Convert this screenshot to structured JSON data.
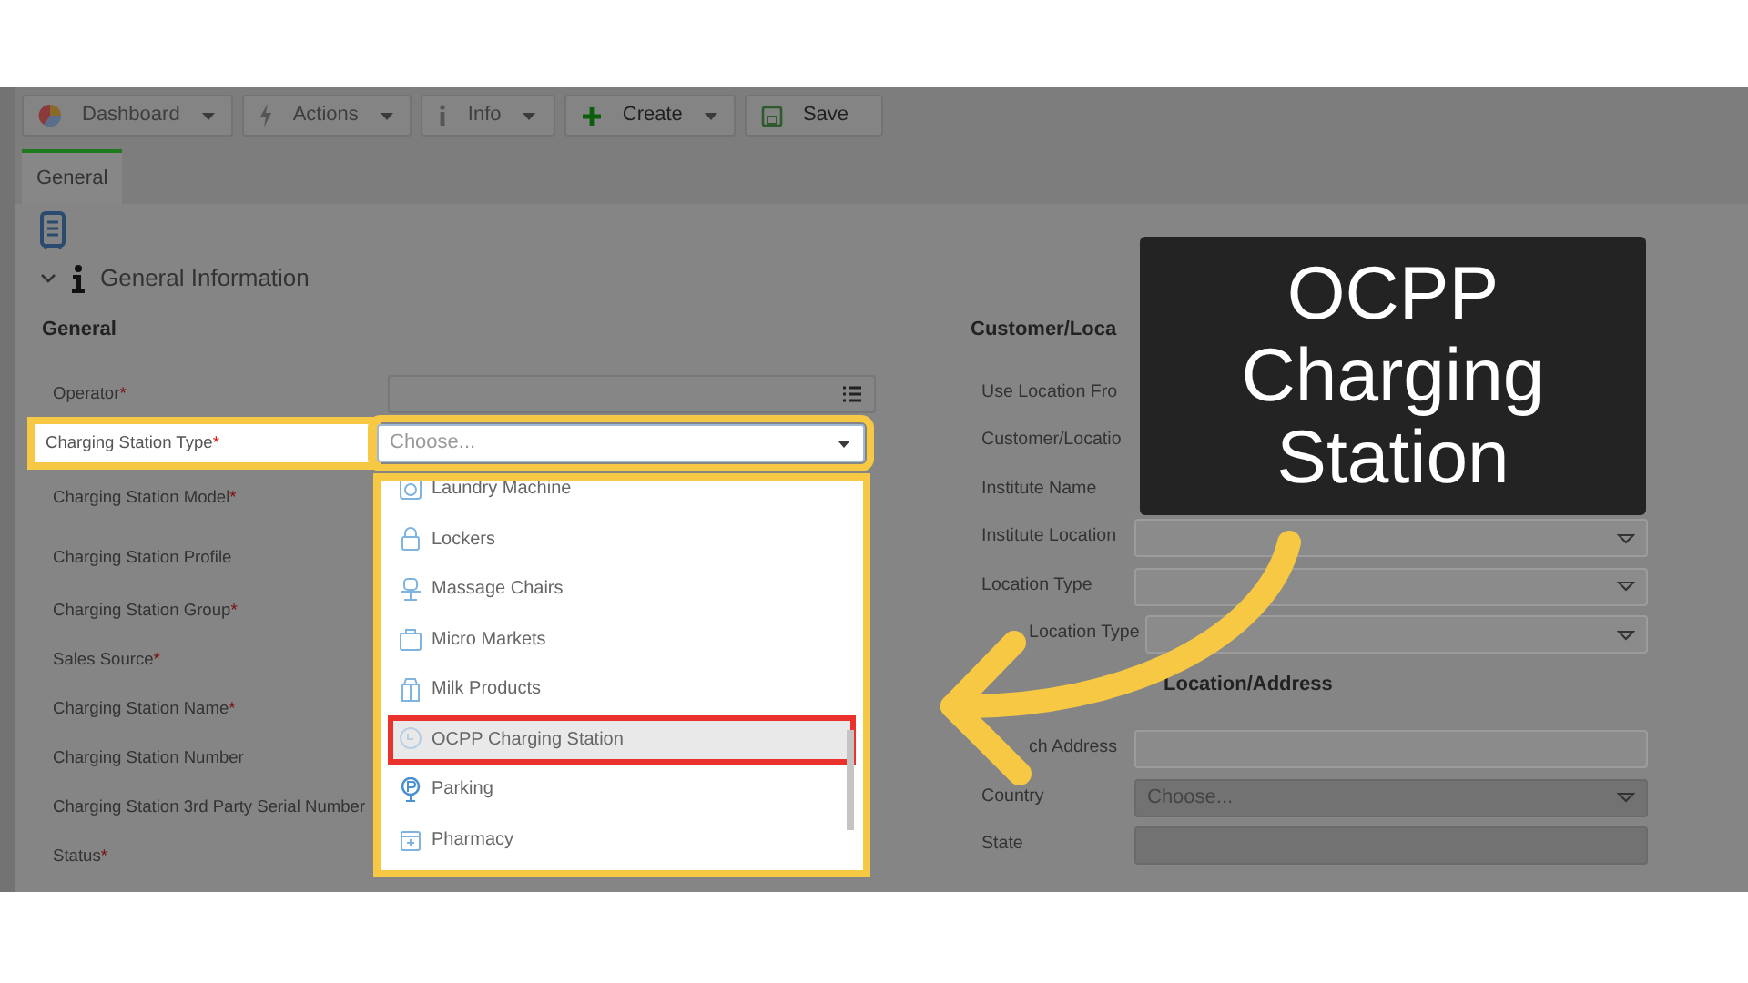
{
  "toolbar": [
    {
      "label": "Dashboard",
      "has_menu": true
    },
    {
      "label": "Actions",
      "has_menu": true
    },
    {
      "label": "Info",
      "has_menu": true
    },
    {
      "label": "Create",
      "has_menu": true
    },
    {
      "label": "Save",
      "has_menu": false
    }
  ],
  "tabs": [
    {
      "label": "General",
      "selected": true
    }
  ],
  "section": {
    "title": "General Information",
    "expanded": true
  },
  "left_column": {
    "heading": "General",
    "fields": [
      {
        "label": "Operator",
        "required_mark": "*",
        "kind": "list"
      },
      {
        "label": "Charging Station Type",
        "required_mark": "*",
        "kind": "open",
        "placeholder": "Choose...",
        "options": [
          {
            "label": "Laundry Machine",
            "selected": false
          },
          {
            "label": "Lockers",
            "selected": false
          },
          {
            "label": "Massage Chairs",
            "selected": false
          },
          {
            "label": "Micro Markets",
            "selected": false
          },
          {
            "label": "Milk Products",
            "selected": false
          },
          {
            "label": "OCPP Charging Station",
            "selected": true
          },
          {
            "label": "Parking",
            "selected": false
          },
          {
            "label": "Pharmacy",
            "selected": false
          }
        ]
      },
      {
        "label": "Charging Station Model",
        "required_mark": "*",
        "kind": "hidden"
      },
      {
        "label": "Charging Station Profile",
        "kind": "hidden"
      },
      {
        "label": "Charging Station Group",
        "required_mark": "*",
        "kind": "hidden"
      },
      {
        "label": "Sales Source",
        "required_mark": "*",
        "kind": "hidden"
      },
      {
        "label": "Charging Station Name",
        "required_mark": "*",
        "kind": "hidden"
      },
      {
        "label": "Charging Station Number",
        "kind": "hidden"
      },
      {
        "label": "Charging Station 3rd Party Serial Number",
        "kind": "hidden"
      },
      {
        "label": "Status",
        "required_mark": "*",
        "kind": "hidden"
      }
    ]
  },
  "right_column": {
    "sections": [
      {
        "heading": "Customer/Loca",
        "heading_cut": false,
        "fields": [
          {
            "label": "Use Location Fro",
            "kind": "hidden",
            "label_cut": false
          },
          {
            "label": "Customer/Locatio",
            "kind": "hidden",
            "label_cut": false
          },
          {
            "label": "Institute Name",
            "kind": "hidden",
            "label_cut": false
          },
          {
            "label": "Institute Location",
            "kind": "select",
            "label_cut": false,
            "disabled": false
          },
          {
            "label": "Location Type",
            "kind": "select",
            "label_cut": false,
            "disabled": false
          },
          {
            "label": "Location Type",
            "kind": "select",
            "label_cut": true,
            "disabled": false
          }
        ]
      },
      {
        "heading": "Location/Address",
        "heading_cut": true,
        "fields": [
          {
            "label": "ch Address",
            "kind": "plain",
            "label_cut": true,
            "disabled": false
          },
          {
            "label": "Country",
            "kind": "select",
            "placeholder": "Choose...",
            "label_cut": false,
            "disabled": true
          },
          {
            "label": "State",
            "kind": "plain",
            "label_cut": false,
            "disabled": true
          }
        ]
      }
    ]
  },
  "callout": {
    "text": "OCPP Charging Station"
  }
}
